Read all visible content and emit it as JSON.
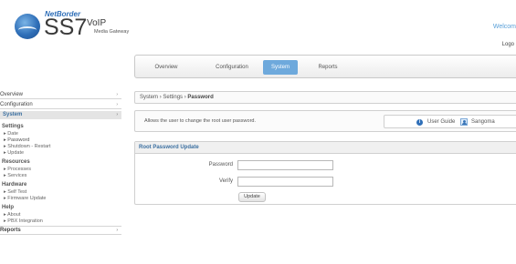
{
  "header": {
    "brand": "NetBorder",
    "product": "SS7",
    "voip": "VoIP",
    "subtitle": "Media Gateway",
    "welcome": "Welcom",
    "logout": "Logo"
  },
  "topnav": {
    "tabs": [
      {
        "label": "Overview"
      },
      {
        "label": "Configuration"
      },
      {
        "label": "System"
      },
      {
        "label": "Reports"
      }
    ],
    "active": "System"
  },
  "sidebar": {
    "overview": "Overview",
    "configuration": "Configuration",
    "system": "System",
    "settings_heading": "Settings",
    "settings": [
      "Date",
      "Password",
      "Shutdown - Restart",
      "Update"
    ],
    "resources_heading": "Resources",
    "resources": [
      "Processes",
      "Services"
    ],
    "hardware_heading": "Hardware",
    "hardware": [
      "Self Test",
      "Firmware Update"
    ],
    "help_heading": "Help",
    "help": [
      "About",
      "PBX Integration"
    ],
    "reports": "Reports"
  },
  "breadcrumb": {
    "system": "System",
    "settings": "Settings",
    "current": "Password",
    "separator": "›"
  },
  "description": {
    "text": "Allows the user to change the root user password.",
    "user_guide": "User Guide",
    "sangoma": "Sangoma"
  },
  "form": {
    "title": "Root Password Update",
    "password_label": "Password",
    "verify_label": "Verify",
    "password_value": "",
    "verify_value": "",
    "update_label": "Update"
  },
  "colors": {
    "accent": "#6ea9dc",
    "link": "#3b6fa0",
    "brand_blue": "#2f6fb8"
  }
}
